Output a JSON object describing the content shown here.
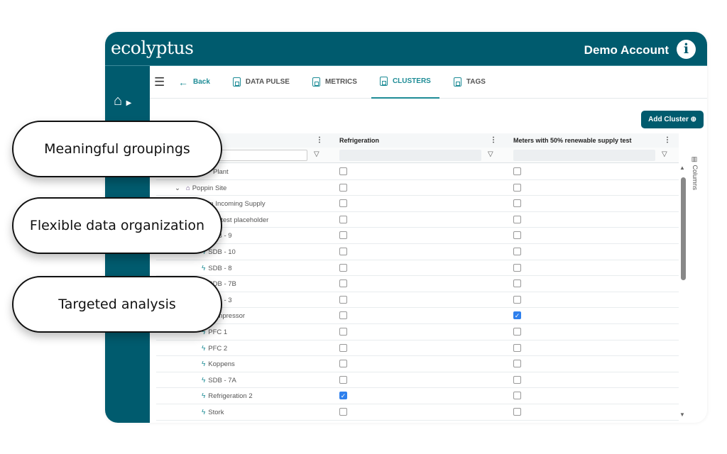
{
  "header": {
    "logo": "ecolyptus",
    "account": "Demo Account",
    "info_icon": "i"
  },
  "nav": {
    "back": "Back",
    "tabs": [
      {
        "label": "DATA PULSE"
      },
      {
        "label": "METRICS"
      },
      {
        "label": "CLUSTERS",
        "active": true
      },
      {
        "label": "TAGS"
      }
    ]
  },
  "add_cluster": "Add Cluster ⊕",
  "grid": {
    "columns": [
      "Refrigeration",
      "Meters with 50% renewable supply test"
    ],
    "columns_panel": "Columns",
    "rows": [
      {
        "name": "Plant",
        "type": "none",
        "c1": false,
        "c2": false
      },
      {
        "name": "Poppin Site",
        "type": "site",
        "c1": false,
        "c2": false
      },
      {
        "name": "in Incoming Supply",
        "type": "meter",
        "c1": false,
        "c2": false
      },
      {
        "name": "ium test placeholder",
        "type": "meter",
        "c1": false,
        "c2": false
      },
      {
        "name": "SDB - 9",
        "type": "meter",
        "c1": false,
        "c2": false
      },
      {
        "name": "SDB - 10",
        "type": "meter",
        "c1": false,
        "c2": false
      },
      {
        "name": "SDB - 8",
        "type": "meter",
        "c1": false,
        "c2": false
      },
      {
        "name": "SDB - 7B",
        "type": "meter",
        "c1": false,
        "c2": false
      },
      {
        "name": "SDB - 3",
        "type": "meter",
        "c1": false,
        "c2": false
      },
      {
        "name": "Compressor",
        "type": "meter",
        "c1": false,
        "c2": true
      },
      {
        "name": "PFC 1",
        "type": "meter",
        "c1": false,
        "c2": false
      },
      {
        "name": "PFC 2",
        "type": "meter",
        "c1": false,
        "c2": false
      },
      {
        "name": "Koppens",
        "type": "meter",
        "c1": false,
        "c2": false
      },
      {
        "name": "SDB - 7A",
        "type": "meter",
        "c1": false,
        "c2": false
      },
      {
        "name": "Refrigeration 2",
        "type": "meter",
        "c1": true,
        "c2": false
      },
      {
        "name": "Stork",
        "type": "meter",
        "c1": false,
        "c2": false
      }
    ]
  },
  "callouts": [
    "Meaningful groupings",
    "Flexible data organization",
    "Targeted analysis"
  ]
}
